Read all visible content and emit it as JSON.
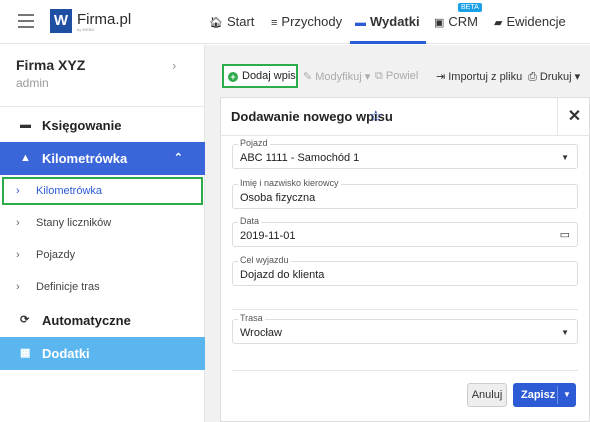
{
  "app": {
    "name": "Firma.pl",
    "logo_letter": "W",
    "logo_sub": "by WEBD"
  },
  "nav": {
    "items": [
      {
        "label": "Start",
        "icon": "home-icon",
        "glyph": "🏠︎"
      },
      {
        "label": "Przychody",
        "icon": "coins-icon",
        "glyph": "≡"
      },
      {
        "label": "Wydatki",
        "icon": "wallet-icon",
        "glyph": "▬"
      },
      {
        "label": "CRM",
        "icon": "contact-icon",
        "glyph": "▣"
      },
      {
        "label": "Ewidencje",
        "icon": "folder-icon",
        "glyph": "▰"
      }
    ],
    "active": "Wydatki",
    "beta_label": "BETA"
  },
  "sidebar": {
    "company": "Firma XYZ",
    "role": "admin",
    "items": {
      "ksiegowanie": "Księgowanie",
      "kilometrowka": "Kilometrówka",
      "sub": [
        "Kilometrówka",
        "Stany liczników",
        "Pojazdy",
        "Definicje tras"
      ],
      "automatyczne": "Automatyczne",
      "dodatki": "Dodatki"
    }
  },
  "toolbar": {
    "add": "Dodaj wpis",
    "modify": "Modyfikuj",
    "repeat": "Powiel",
    "import": "Importuj z pliku",
    "print": "Drukuj"
  },
  "modal": {
    "title": "Dodawanie nowego wpisu",
    "fields": {
      "vehicle": {
        "label": "Pojazd",
        "value": "ABC 1111 - Samochód 1"
      },
      "driver": {
        "label": "Imię i nazwisko kierowcy",
        "value": "Osoba fizyczna"
      },
      "date": {
        "label": "Data",
        "value": "2019-11-01"
      },
      "purpose": {
        "label": "Cel wyjazdu",
        "value": "Dojazd do klienta"
      },
      "route": {
        "label": "Trasa",
        "value": "Wrocław"
      }
    },
    "cancel": "Anuluj",
    "save": "Zapisz"
  },
  "colors": {
    "accent": "#2d5bd6",
    "sidebar_active": "#3a66d9",
    "dodatki": "#5bb6f0",
    "highlight": "#2eab4a"
  }
}
